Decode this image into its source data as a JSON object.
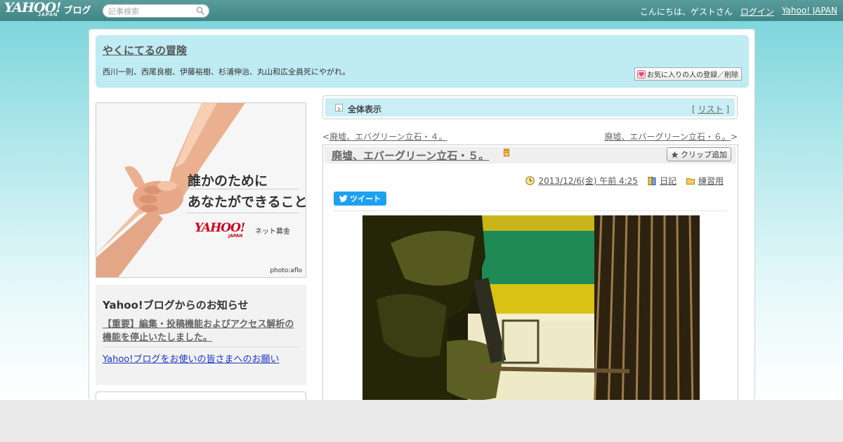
{
  "header": {
    "logo_main": "YAHOO!",
    "logo_sub": "JAPAN",
    "logo_blog": "ブログ",
    "search_placeholder": "記事検索",
    "greeting": "こんにちは、ゲストさん",
    "login": "ログイン",
    "yahoo_japan": "Yahoo! JAPAN"
  },
  "blog": {
    "title": "やくにてるの冒険",
    "description": "西川一則、西尾良樹、伊藤裕樹、杉浦伸治、丸山和広全員死にやがれ。",
    "fav_button": "お気に入りの人の登録／削除"
  },
  "ad": {
    "line1": "誰かのために",
    "line2": "あなたができること",
    "logo": "YAHOO!",
    "logo_sub": "JAPAN",
    "service": "ネット募金",
    "credit": "photo:aflo"
  },
  "notice": {
    "title": "Yahoo!ブログからのお知らせ",
    "link1": "【重要】編集・投稿機能およびアクセス解析の機能を停止いたしました。",
    "link2": "Yahoo!ブログをお使いの皆さまへのお願い"
  },
  "nav": {
    "all_label": "全体表示",
    "list_open": "[",
    "list_label": "リスト",
    "list_close": "]",
    "prev_arrow": "<",
    "prev_title": "廃墟、エバグリーン立石・４。",
    "next_title": "廃墟、エバーグリーン立石・６。",
    "next_arrow": ">"
  },
  "article": {
    "title": "廃墟、エバーグリーン立石・５。",
    "clip_button": "クリップ追加",
    "date": "2013/12/6(金) 午前 4:25",
    "category": "日記",
    "folder": "練習用",
    "tweet": "ツイート"
  },
  "colors": {
    "topbar": "#3f8585",
    "header_bg": "#bfebf3",
    "link_blue": "#1a35c7",
    "tweet_blue": "#1da1f2"
  }
}
